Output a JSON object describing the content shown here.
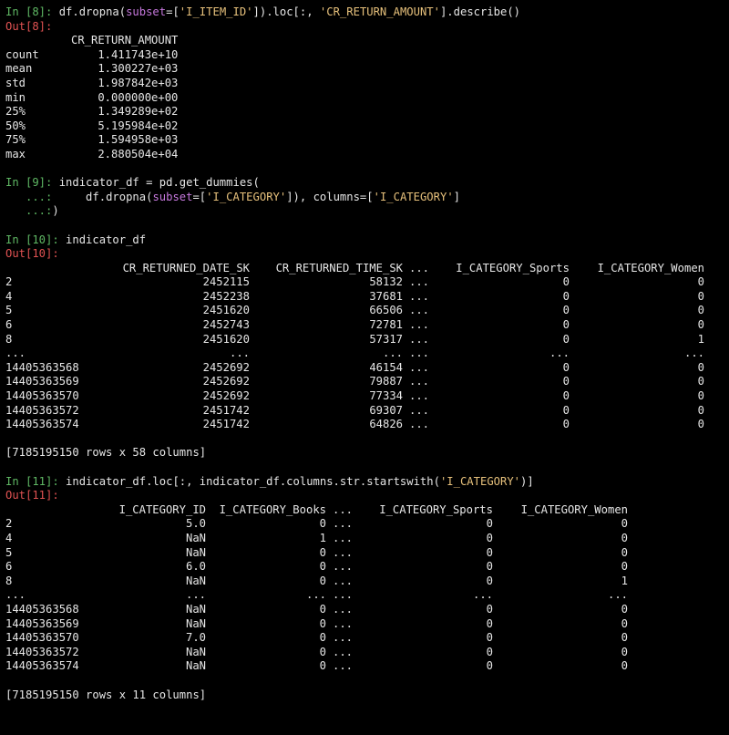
{
  "cells": {
    "c8": {
      "in_prompt": "In [8]: ",
      "code": {
        "a": "df.dropna(",
        "kw": "subset",
        "b": "=[",
        "s1": "'I_ITEM_ID'",
        "c": "]).loc[:, ",
        "s2": "'CR_RETURN_AMOUNT'",
        "d": "].describe()"
      },
      "out_prompt": "Out[8]:",
      "column": "CR_RETURN_AMOUNT",
      "rows": [
        {
          "label": "count",
          "value": "1.411743e+10"
        },
        {
          "label": "mean",
          "value": "1.300227e+03"
        },
        {
          "label": "std",
          "value": "1.987842e+03"
        },
        {
          "label": "min",
          "value": "0.000000e+00"
        },
        {
          "label": "25%",
          "value": "1.349289e+02"
        },
        {
          "label": "50%",
          "value": "5.195984e+02"
        },
        {
          "label": "75%",
          "value": "1.594958e+03"
        },
        {
          "label": "max",
          "value": "2.880504e+04"
        }
      ]
    },
    "c9": {
      "in_prompt": "In [9]: ",
      "line1": "indicator_df = pd.get_dummies(",
      "cont1": "   ...:",
      "line2": {
        "a": "     df.dropna(",
        "kw": "subset",
        "b": "=[",
        "s1": "'I_CATEGORY'",
        "c": "]), columns=[",
        "s2": "'I_CATEGORY'",
        "d": "]"
      },
      "cont2": "   ...:",
      "line3": ")"
    },
    "c10": {
      "in_prompt": "In [10]: ",
      "code": "indicator_df",
      "out_prompt": "Out[10]:",
      "headers": [
        "",
        "CR_RETURNED_DATE_SK",
        "CR_RETURNED_TIME_SK",
        "...",
        "I_CATEGORY_Sports",
        "I_CATEGORY_Women"
      ],
      "rows": [
        [
          "2",
          "2452115",
          "58132",
          "...",
          "0",
          "0"
        ],
        [
          "4",
          "2452238",
          "37681",
          "...",
          "0",
          "0"
        ],
        [
          "5",
          "2451620",
          "66506",
          "...",
          "0",
          "0"
        ],
        [
          "6",
          "2452743",
          "72781",
          "...",
          "0",
          "0"
        ],
        [
          "8",
          "2451620",
          "57317",
          "...",
          "0",
          "1"
        ],
        [
          "...",
          "...",
          "...",
          "...",
          "...",
          "..."
        ],
        [
          "14405363568",
          "2452692",
          "46154",
          "...",
          "0",
          "0"
        ],
        [
          "14405363569",
          "2452692",
          "79887",
          "...",
          "0",
          "0"
        ],
        [
          "14405363570",
          "2452692",
          "77334",
          "...",
          "0",
          "0"
        ],
        [
          "14405363572",
          "2451742",
          "69307",
          "...",
          "0",
          "0"
        ],
        [
          "14405363574",
          "2451742",
          "64826",
          "...",
          "0",
          "0"
        ]
      ],
      "summary": "[7185195150 rows x 58 columns]"
    },
    "c11": {
      "in_prompt": "In [11]: ",
      "code": {
        "a": "indicator_df.loc[:, indicator_df.columns.str.startswith(",
        "s1": "'I_CATEGORY'",
        "b": ")]"
      },
      "out_prompt": "Out[11]:",
      "headers": [
        "",
        "I_CATEGORY_ID",
        "I_CATEGORY_Books",
        "...",
        "I_CATEGORY_Sports",
        "I_CATEGORY_Women"
      ],
      "rows": [
        [
          "2",
          "5.0",
          "0",
          "...",
          "0",
          "0"
        ],
        [
          "4",
          "NaN",
          "1",
          "...",
          "0",
          "0"
        ],
        [
          "5",
          "NaN",
          "0",
          "...",
          "0",
          "0"
        ],
        [
          "6",
          "6.0",
          "0",
          "...",
          "0",
          "0"
        ],
        [
          "8",
          "NaN",
          "0",
          "...",
          "0",
          "1"
        ],
        [
          "...",
          "...",
          "...",
          "...",
          "...",
          "..."
        ],
        [
          "14405363568",
          "NaN",
          "0",
          "...",
          "0",
          "0"
        ],
        [
          "14405363569",
          "NaN",
          "0",
          "...",
          "0",
          "0"
        ],
        [
          "14405363570",
          "7.0",
          "0",
          "...",
          "0",
          "0"
        ],
        [
          "14405363572",
          "NaN",
          "0",
          "...",
          "0",
          "0"
        ],
        [
          "14405363574",
          "NaN",
          "0",
          "...",
          "0",
          "0"
        ]
      ],
      "summary": "[7185195150 rows x 11 columns]"
    }
  },
  "colors": {
    "background": "#000000",
    "text": "#e6e6e6",
    "in_prompt": "#5fb864",
    "out_prompt": "#e05252",
    "string": "#e6c07b",
    "keyword": "#c678dd"
  }
}
